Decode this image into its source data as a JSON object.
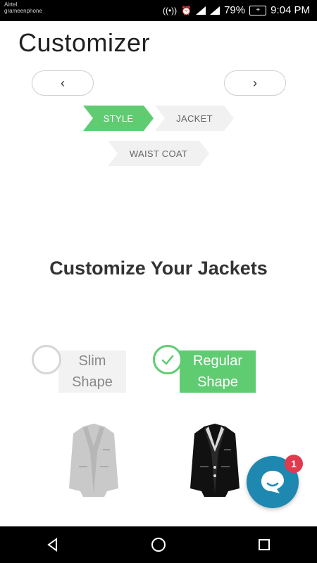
{
  "status": {
    "carrier_line1": "Airtel",
    "carrier_line2": "grameenphone",
    "battery": "79%",
    "time": "9:04 PM"
  },
  "header": {
    "title": "Customizer"
  },
  "nav": {
    "prev_label": "‹",
    "next_label": "›"
  },
  "steps": [
    {
      "label": "STYLE",
      "active": true
    },
    {
      "label": "JACKET",
      "active": false
    },
    {
      "label": "WAIST COAT",
      "active": false
    }
  ],
  "section": {
    "title": "Customize Your Jackets"
  },
  "shapes": [
    {
      "label": "Slim Shape",
      "selected": false
    },
    {
      "label": "Regular Shape",
      "selected": true
    }
  ],
  "chat": {
    "badge_count": "1"
  },
  "colors": {
    "accent_green": "#5fcc72",
    "chat_blue": "#1e88b0",
    "badge_red": "#e03a4f"
  }
}
